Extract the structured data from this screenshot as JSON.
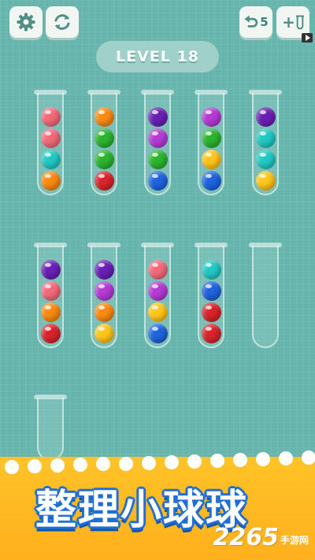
{
  "toolbar": {
    "settings_icon": "gear-icon",
    "restart_icon": "refresh-icon",
    "undo_icon": "undo-icon",
    "undo_count": "5",
    "add_tube_icon": "add-tube-icon",
    "add_tube_label": "+"
  },
  "level": {
    "label": "LEVEL 18"
  },
  "colors": {
    "pink": "#f26a7a",
    "orange": "#fb8a12",
    "teal": "#22c9c4",
    "green": "#2bb52e",
    "red": "#d9242a",
    "purple": "#6a1fb5",
    "violet": "#b53ad6",
    "yellow": "#ffc51a",
    "blue": "#1f63e0"
  },
  "tubes": [
    {
      "balls": [
        "pink",
        "pink",
        "teal",
        "orange"
      ]
    },
    {
      "balls": [
        "orange",
        "green",
        "green",
        "red"
      ]
    },
    {
      "balls": [
        "purple",
        "violet",
        "green",
        "blue"
      ]
    },
    {
      "balls": [
        "violet",
        "green",
        "yellow",
        "blue"
      ]
    },
    {
      "balls": [
        "purple",
        "teal",
        "teal",
        "yellow"
      ]
    },
    {
      "balls": [
        "purple",
        "pink",
        "orange",
        "red"
      ]
    },
    {
      "balls": [
        "purple",
        "violet",
        "orange",
        "yellow"
      ]
    },
    {
      "balls": [
        "pink",
        "violet",
        "yellow",
        "blue"
      ]
    },
    {
      "balls": [
        "teal",
        "blue",
        "red",
        "red"
      ]
    },
    {
      "balls": []
    },
    {
      "balls": []
    }
  ],
  "banner": {
    "title": "整理小球球"
  },
  "watermark": {
    "number": "2265",
    "suffix": "手游网"
  }
}
